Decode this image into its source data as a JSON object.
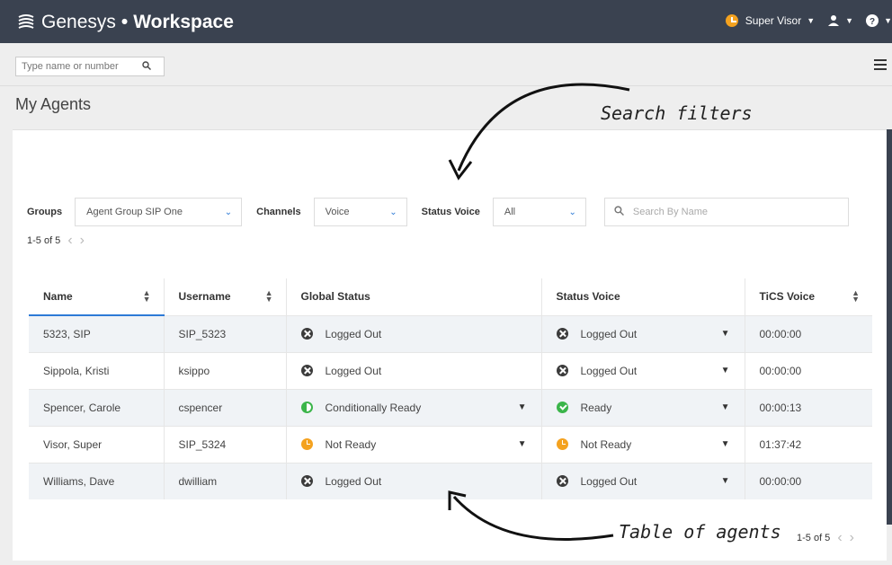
{
  "header": {
    "brand": "Genesys",
    "separator": "•",
    "product": "Workspace",
    "user_name": "Super Visor",
    "accent": "#f4a21f",
    "bg": "#3a4250"
  },
  "toolbar": {
    "search_placeholder": "Type name or number"
  },
  "page": {
    "title": "My Agents"
  },
  "filters": {
    "groups_label": "Groups",
    "groups_value": "Agent Group SIP One",
    "channels_label": "Channels",
    "channels_value": "Voice",
    "status_label": "Status Voice",
    "status_value": "All",
    "search_placeholder": "Search By Name"
  },
  "pagination": {
    "top_range": "1-5 of 5",
    "bottom_range": "1-5 of 5"
  },
  "table": {
    "columns": [
      "Name",
      "Username",
      "Global Status",
      "Status Voice",
      "TiCS Voice"
    ],
    "rows": [
      {
        "name": "5323, SIP",
        "username": "SIP_5323",
        "global_status": "Logged Out",
        "global_icon": "logged-out",
        "voice_status": "Logged Out",
        "voice_icon": "logged-out",
        "tics": "00:00:00"
      },
      {
        "name": "Sippola, Kristi",
        "username": "ksippo",
        "global_status": "Logged Out",
        "global_icon": "logged-out",
        "voice_status": "Logged Out",
        "voice_icon": "logged-out",
        "tics": "00:00:00"
      },
      {
        "name": "Spencer, Carole",
        "username": "cspencer",
        "global_status": "Conditionally Ready",
        "global_icon": "conditionally-ready",
        "voice_status": "Ready",
        "voice_icon": "ready",
        "tics": "00:00:13"
      },
      {
        "name": "Visor, Super",
        "username": "SIP_5324",
        "global_status": "Not Ready",
        "global_icon": "not-ready",
        "voice_status": "Not Ready",
        "voice_icon": "not-ready",
        "tics": "01:37:42"
      },
      {
        "name": "Williams, Dave",
        "username": "dwilliam",
        "global_status": "Logged Out",
        "global_icon": "logged-out",
        "voice_status": "Logged Out",
        "voice_icon": "logged-out",
        "tics": "00:00:00"
      }
    ]
  },
  "annotations": {
    "search_filters": "Search filters",
    "table_of_agents": "Table of agents"
  }
}
